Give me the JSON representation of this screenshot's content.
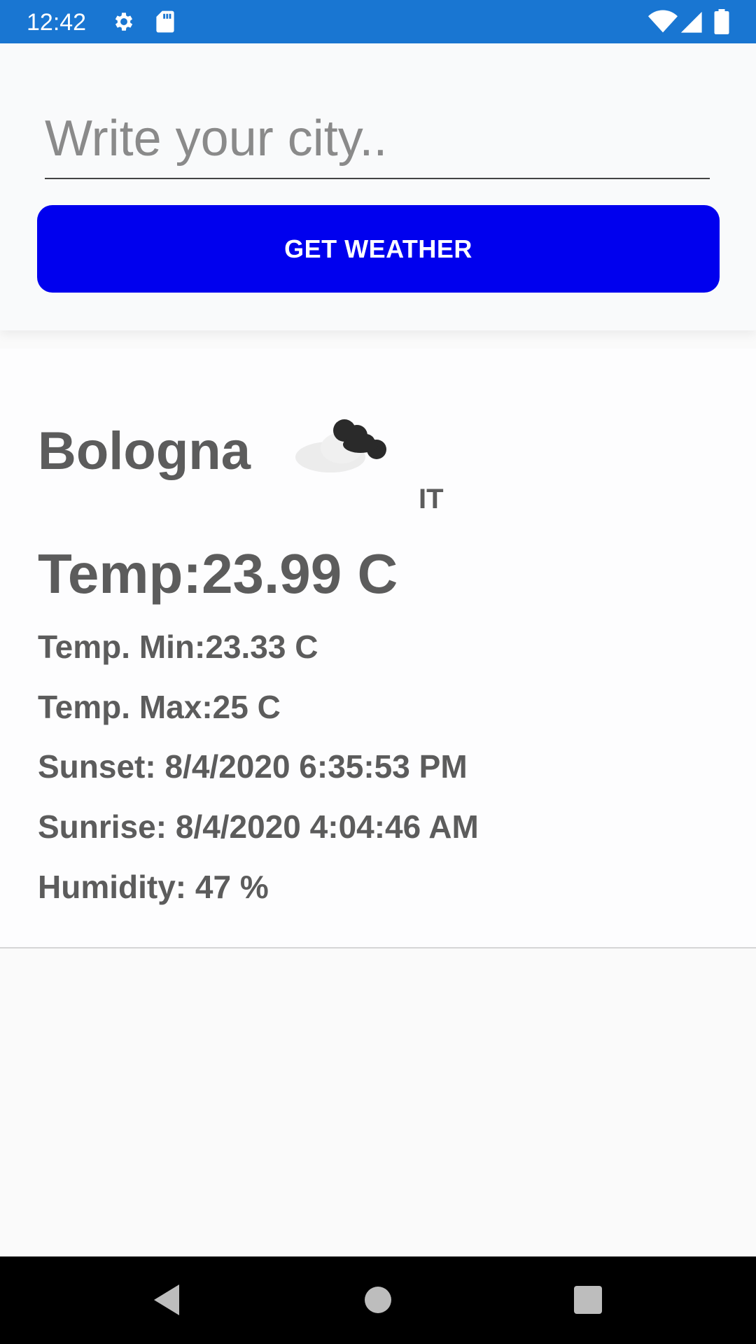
{
  "status_bar": {
    "time": "12:42",
    "background_color": "#1976d2",
    "icons": [
      "gear-icon",
      "sd-card-icon",
      "wifi-icon",
      "signal-icon",
      "battery-icon"
    ]
  },
  "search": {
    "placeholder": "Write your city..",
    "value": "",
    "button_label": "GET WEATHER",
    "button_color": "#0000ee"
  },
  "weather": {
    "city": "Bologna",
    "country": "IT",
    "icon": "cloud-icon",
    "temp": "Temp:23.99 C",
    "temp_min": "Temp. Min:23.33 C",
    "temp_max": "Temp. Max:25 C",
    "sunset": "Sunset: 8/4/2020 6:35:53 PM",
    "sunrise": "Sunrise: 8/4/2020 4:04:46 AM",
    "humidity": "Humidity: 47 %"
  },
  "nav_bar": {
    "icons": [
      "back-icon",
      "home-icon",
      "recents-icon"
    ]
  }
}
